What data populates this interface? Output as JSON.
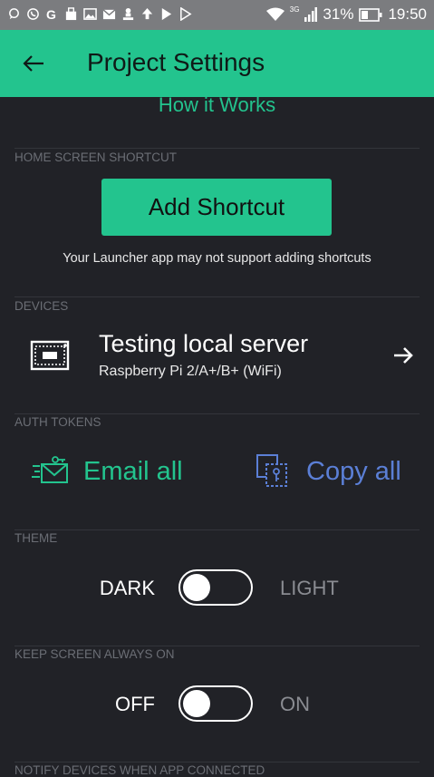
{
  "statusbar": {
    "network": "3G",
    "battery": "31%",
    "time": "19:50"
  },
  "appbar": {
    "title": "Project Settings"
  },
  "how_it_works": "How it Works",
  "home_shortcut": {
    "section_label": "HOME SCREEN SHORTCUT",
    "button_label": "Add Shortcut",
    "hint": "Your Launcher app may not support adding shortcuts"
  },
  "devices": {
    "section_label": "DEVICES",
    "items": [
      {
        "name": "Testing local server",
        "model": "Raspberry Pi 2/A+/B+ (WiFi)"
      }
    ]
  },
  "auth_tokens": {
    "section_label": "AUTH TOKENS",
    "email_label": "Email all",
    "copy_label": "Copy all"
  },
  "theme": {
    "section_label": "THEME",
    "left_label": "DARK",
    "right_label": "LIGHT"
  },
  "keep_screen": {
    "section_label": "KEEP SCREEN ALWAYS ON",
    "left_label": "OFF",
    "right_label": "ON"
  },
  "notify": {
    "section_label": "NOTIFY DEVICES WHEN APP CONNECTED"
  },
  "colors": {
    "accent": "#23c48e",
    "background": "#212227",
    "copy_blue": "#5b7fd6"
  }
}
